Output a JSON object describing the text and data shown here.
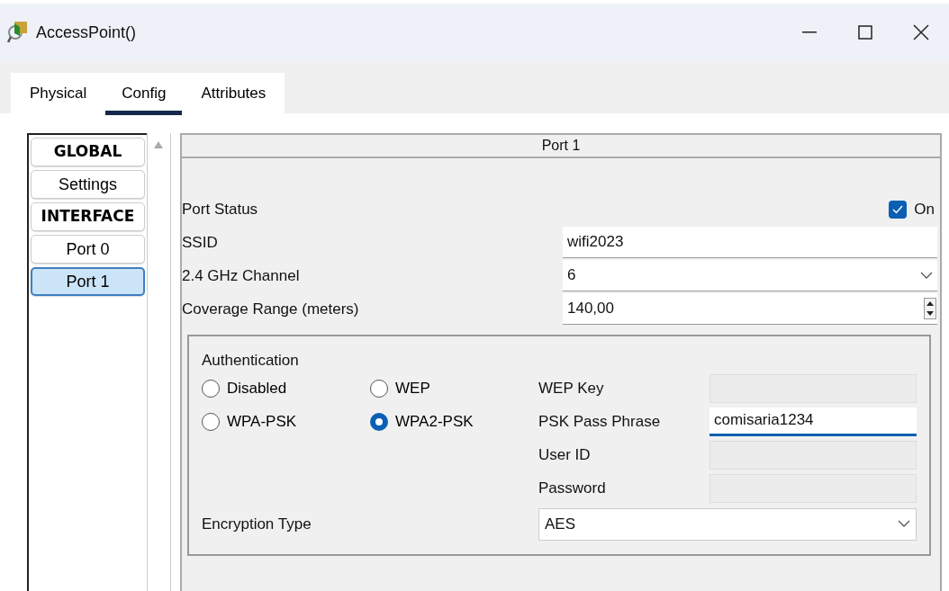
{
  "window": {
    "title": "AccessPoint()"
  },
  "tabs": [
    {
      "label": "Physical",
      "selected": false
    },
    {
      "label": "Config",
      "selected": true
    },
    {
      "label": "Attributes",
      "selected": false
    }
  ],
  "sidebar": {
    "items": [
      {
        "label": "GLOBAL",
        "kind": "heading",
        "selected": false
      },
      {
        "label": "Settings",
        "kind": "item",
        "selected": false
      },
      {
        "label": "INTERFACE",
        "kind": "heading",
        "selected": false
      },
      {
        "label": "Port 0",
        "kind": "item",
        "selected": false
      },
      {
        "label": "Port 1",
        "kind": "item",
        "selected": true
      }
    ]
  },
  "panel": {
    "title": "Port 1",
    "port_status": {
      "label": "Port Status",
      "checked": true,
      "text": "On"
    },
    "rows": [
      {
        "label": "SSID",
        "kind": "text",
        "value": "wifi2023"
      },
      {
        "label": "2.4 GHz Channel",
        "kind": "select",
        "value": "6"
      },
      {
        "label": "Coverage Range (meters)",
        "kind": "spinner",
        "value": "140,00"
      }
    ],
    "authentication": {
      "title": "Authentication",
      "options": [
        {
          "label": "Disabled",
          "selected": false
        },
        {
          "label": "WEP",
          "selected": false
        },
        {
          "label": "WPA-PSK",
          "selected": false
        },
        {
          "label": "WPA2-PSK",
          "selected": true
        }
      ],
      "fields": [
        {
          "label": "WEP Key",
          "disabled": true
        },
        {
          "label": "PSK Pass Phrase",
          "value": "comisaria1234",
          "disabled": false
        },
        {
          "label": "User ID",
          "disabled": true
        },
        {
          "label": "Password",
          "disabled": true
        }
      ],
      "encryption": {
        "label": "Encryption Type",
        "value": "AES"
      }
    }
  }
}
